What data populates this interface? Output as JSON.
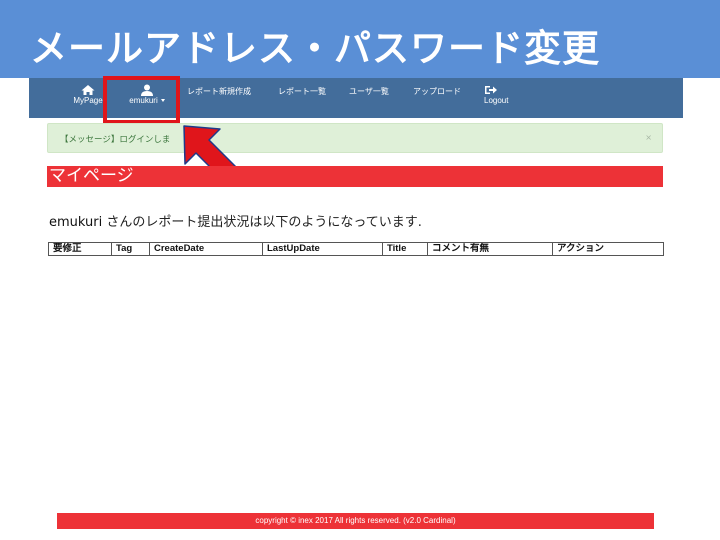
{
  "slide": {
    "title": "メールアドレス・パスワード変更"
  },
  "navbar": {
    "items": [
      {
        "label": "MyPage",
        "icon": "home-icon"
      },
      {
        "label": "emukuri",
        "icon": "user-icon",
        "dropdown": true
      },
      {
        "label": "レポート新規作成"
      },
      {
        "label": "レポート一覧"
      },
      {
        "label": "ユーザ一覧"
      },
      {
        "label": "アップロード"
      },
      {
        "label": "Logout",
        "icon": "logout-icon"
      }
    ]
  },
  "alert": {
    "message": "【メッセージ】ログインしま",
    "close": "×"
  },
  "page": {
    "heading": "マイページ",
    "user": "emukuri",
    "status_text": " さんのレポート提出状況は以下のようになっています."
  },
  "table": {
    "columns": [
      "要修正",
      "Tag",
      "CreateDate",
      "LastUpDate",
      "Title",
      "コメント有無",
      "アクション"
    ]
  },
  "footer": {
    "text": "copyright © inex 2017 All rights reserved. (v2.0 Cardinal)"
  },
  "colors": {
    "title_band": "#5a8fd6",
    "navbar": "#436d9b",
    "accent_red": "#ed3237",
    "highlight": "#e0151b",
    "alert_bg": "#dff0d8"
  }
}
